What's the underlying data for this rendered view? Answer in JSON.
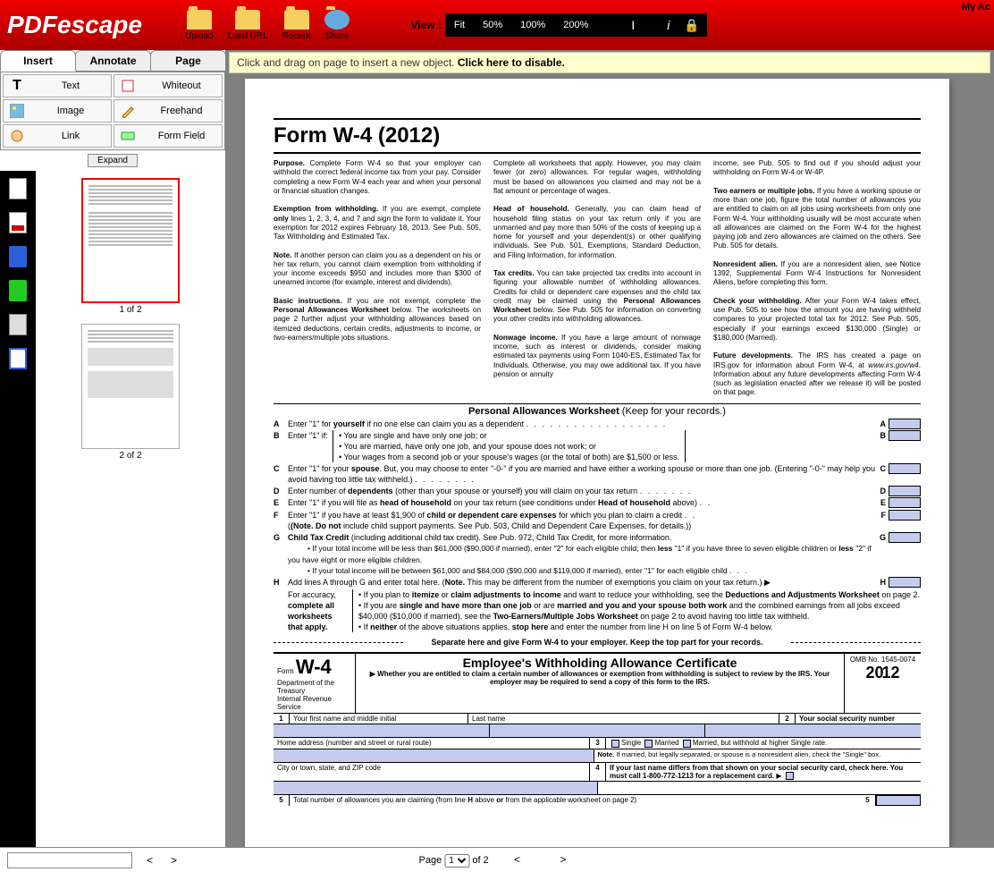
{
  "app": {
    "logo": "PDFescape",
    "my_account": "My Ac"
  },
  "toolbar": {
    "upload": "Upload",
    "load_url": "Load URL",
    "recent": "Recent",
    "share": "Share",
    "view_label": "View :",
    "zoom": {
      "fit": "Fit",
      "p50": "50%",
      "p100": "100%",
      "p200": "200%"
    }
  },
  "tabs": {
    "insert": "Insert",
    "annotate": "Annotate",
    "page": "Page"
  },
  "tools": {
    "text": "Text",
    "whiteout": "Whiteout",
    "image": "Image",
    "freehand": "Freehand",
    "link": "Link",
    "form_field": "Form Field",
    "expand": "Expand"
  },
  "thumbs": {
    "p1": "1 of 2",
    "p2": "2 of 2"
  },
  "hint": {
    "a": "Click and drag on page to insert a new object. ",
    "b": "Click here to disable."
  },
  "bottom": {
    "prev": "<",
    "next": ">",
    "page": "Page",
    "of": "of 2",
    "sel": "1"
  },
  "doc": {
    "title": "Form W-4 (2012)",
    "col1": {
      "purpose_h": "Purpose.",
      "purpose": " Complete Form W-4 so that your employer can withhold the correct federal income tax from your pay. Consider completing a new Form W-4 each year and when your personal or financial situation changes.",
      "exempt_h": "Exemption from withholding.",
      "exempt": " If you are exempt, complete ",
      "only": "only",
      "exempt2": " lines 1, 2, 3, 4, and 7 and sign the form to validate it. Your exemption for 2012 expires February 18, 2013. See Pub. 505, Tax Withholding and Estimated Tax.",
      "note_h": "Note.",
      "note": " If another person can claim you as a dependent on his or her tax return, you cannot claim exemption from withholding if your income exceeds $950 and includes more than $300 of unearned income (for example, interest and dividends).",
      "basic_h": "Basic instructions.",
      "basic": " If you are not exempt, complete the ",
      "paw": "Personal Allowances Worksheet",
      "basic2": " below. The worksheets on page 2 further adjust your withholding allowances based on itemized deductions, certain credits, adjustments to income, or two-earners/multiple jobs situations."
    },
    "col2": {
      "a": "Complete all worksheets that apply. However, you may claim fewer (or zero) allowances. For regular wages, withholding must be based on allowances you claimed and may not be a flat amount or percentage of wages.",
      "hoh_h": "Head of household.",
      "hoh": " Generally, you can claim head of household filing status on your tax return only if you are unmarried and pay more than 50% of the costs of keeping up a home for yourself and your dependent(s) or other qualifying individuals. See Pub. 501, Exemptions, Standard Deduction, and Filing Information, for information.",
      "tc_h": "Tax credits.",
      "tc": " You can take projected tax credits into account in figuring your allowable number of withholding allowances. Credits for child or dependent care expenses and the child tax credit may be claimed using the ",
      "paw": "Personal Allowances Worksheet",
      "tc2": " below. See Pub. 505 for information on converting your other credits into withholding allowances.",
      "nw_h": "Nonwage income.",
      "nw": " If you have a large amount of nonwage income, such as interest or dividends, consider making estimated tax payments using Form 1040-ES, Estimated Tax for Individuals. Otherwise, you may owe additional tax. If you have pension or annuity"
    },
    "col3": {
      "a": "income, see Pub. 505 to find out if you should adjust your withholding on Form W-4 or W-4P.",
      "te_h": "Two earners or multiple jobs.",
      "te": " If you have a working spouse or more than one job, figure the total number of allowances you are entitled to claim on all jobs using worksheets from only one Form W-4. Your withholding usually will be most accurate when all allowances are claimed on the Form W-4 for the highest paying job and zero allowances are claimed on the others. See Pub. 505 for details.",
      "nr_h": "Nonresident alien.",
      "nr": " If you are a nonresident alien, see Notice 1392, Supplemental Form W-4 Instructions for Nonresident Aliens, before completing this form.",
      "cw_h": "Check your withholding.",
      "cw": " After your Form W-4 takes effect, use Pub. 505 to see how the amount you are having withheld compares to your projected total tax for 2012. See Pub. 505, especially if your earnings exceed $130,000 (Single) or $180,000 (Married).",
      "fd_h": "Future developments.",
      "fd": " The IRS has created a page on IRS.gov for information about Form W-4, at ",
      "url": "www.irs.gov/w4",
      "fd2": ". Information about any future developments affecting Form W-4 (such as legislation enacted after we release it) will be posted on that page."
    },
    "ws": {
      "head1": "Personal Allowances Worksheet",
      "head2": " (Keep for your records.)",
      "A": "Enter \"1\" for ",
      "Ab": "yourself",
      "A2": " if no one else can claim you as a dependent",
      "B": "Enter \"1\" if:",
      "B1": "You are single and have only one job; or",
      "B2": "You are married, have only one job, and your spouse does not work; or",
      "B3": "Your wages from a second job or your spouse's wages (or the total of both) are $1,500 or less.",
      "C": "Enter \"1\" for your ",
      "Cb": "spouse",
      "C2": ". But, you may choose to enter \"-0-\" if you are married and have either a working spouse or more than one job. (Entering \"-0-\" may help you avoid having too little tax withheld.)",
      "D": "Enter number of ",
      "Db": "dependents",
      "D2": " (other than your spouse or yourself) you will claim on your tax return",
      "E": "Enter \"1\" if you will file as ",
      "Eb": "head of household",
      "E2": " on your tax return (see conditions under ",
      "Eb2": "Head of household",
      "E3": " above)",
      "F": "Enter \"1\" if you have at least $1,900 of ",
      "Fb": "child or dependent care expenses",
      "F2": " for which you plan to claim a credit",
      "Fn": "(Note. Do not",
      "Fn2": " include child support payments. See Pub. 503, Child and Dependent Care Expenses, for details.)",
      "G": "Child Tax Credit",
      "G2": " (including additional child tax credit). See Pub. 972, Child Tax Credit, for more information.",
      "G3": "If your total income will be less than $61,000 ($90,000 if married), enter \"2\" for each eligible child; then ",
      "Gb": "less",
      "G4": " \"1\" if you have three to seven eligible children or ",
      "Gb2": "less",
      "G5": " \"2\" if you have eight or more eligible children.",
      "G6": "If your total income will be between $61,000 and $84,000 ($90,000 and $119,000 if married), enter \"1\" for each eligible child",
      "H": "Add lines A through G and enter total here. (",
      "Hb": "Note.",
      "H2": " This may be different from the number of exemptions you claim on your tax return.)",
      "acc1": "For accuracy,",
      "acc2": "complete all",
      "acc3": "worksheets",
      "acc4": "that apply.",
      "H3": "If you plan to ",
      "Hb3": "itemize",
      "H4": " or ",
      "Hb4": "claim adjustments to income",
      "H5": " and want to reduce your withholding, see the ",
      "Hb5": "Deductions and Adjustments Worksheet",
      "H6": " on page 2.",
      "H7": "If you are ",
      "Hb7": "single and have more than one job",
      "H8": " or are ",
      "Hb8": "married and you and your spouse both work",
      "H9": " and the combined earnings from all jobs exceed $40,000 ($10,000 if married), see the ",
      "Hb9": "Two-Earners/Multiple Jobs Worksheet",
      "H10": " on page 2 to avoid having too little tax withheld.",
      "H11": "If ",
      "Hb11": "neither",
      "H12": " of the above situations applies, ",
      "Hb12": "stop here",
      "H13": " and enter the number from line H on line 5 of Form W-4 below."
    },
    "sep": "Separate here and give Form W-4 to your employer. Keep the top part for your records.",
    "cert": {
      "form": "Form",
      "w4": "W-4",
      "dept": "Department of the Treasury",
      "irs": "Internal Revenue Service",
      "title": "Employee's Withholding Allowance Certificate",
      "sub": "▶ Whether you are entitled to claim a certain number of allowances or exemption from withholding is subject to review by the IRS. Your employer may be required to send a copy of this form to the IRS.",
      "omb": "OMB No. 1545-0074",
      "year": "2012",
      "r1a": "Your first name and middle initial",
      "r1b": "Last name",
      "r1c": "Your social security number",
      "r2": "Home address (number and street or rural route)",
      "r3a": "Single",
      "r3b": "Married",
      "r3c": "Married, but withhold at higher Single rate.",
      "r3n": "Note.",
      "r3n2": " If married, but legally separated, or spouse is a nonresident alien, check the \"Single\" box.",
      "r4": "City or town, state, and ZIP code",
      "r4b": "If your last name differs from that shown on your social security card, check here. You must call 1-800-772-1213 for a replacement card.",
      "r5": "Total number of allowances you are claiming (from line ",
      "r5b": "H",
      "r5c": " above ",
      "r5d": "or",
      "r5e": " from the applicable worksheet on page 2)"
    }
  }
}
